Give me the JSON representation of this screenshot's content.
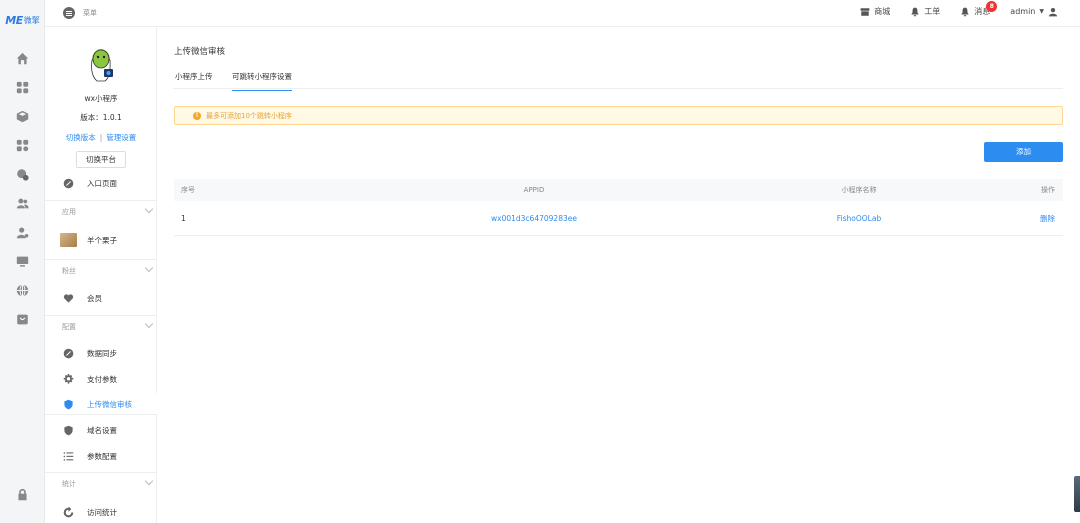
{
  "brand": {
    "logo_text": "ME",
    "logo_cn": "微擎"
  },
  "topbar": {
    "menu_label": "菜单",
    "items": [
      {
        "label": "商城",
        "icon": "store-icon"
      },
      {
        "label": "工单",
        "icon": "bell-icon"
      },
      {
        "label": "消息",
        "icon": "bell-icon",
        "badge": "8"
      }
    ],
    "user": "admin"
  },
  "app": {
    "name": "wx小程序",
    "version": "版本：1.0.1",
    "link_switch_version": "切换版本",
    "link_separator": "|",
    "link_manage": "管理设置",
    "switch_platform": "切换平台"
  },
  "subnav": {
    "entry_page": "入口页面",
    "groups": [
      {
        "title": "应用",
        "items": [
          {
            "label": "羊个栗子"
          }
        ]
      },
      {
        "title": "粉丝",
        "items": [
          {
            "label": "会员"
          }
        ]
      },
      {
        "title": "配置",
        "items": [
          {
            "label": "数据同步"
          },
          {
            "label": "支付参数"
          },
          {
            "label": "上传微信审核",
            "active": true
          },
          {
            "label": "域名设置"
          },
          {
            "label": "参数配置"
          }
        ]
      },
      {
        "title": "统计",
        "items": [
          {
            "label": "访问统计"
          }
        ]
      }
    ]
  },
  "main": {
    "title": "上传微信审核",
    "tabs": [
      {
        "label": "小程序上传",
        "active": false
      },
      {
        "label": "可跳转小程序设置",
        "active": true
      }
    ],
    "alert": "最多可添加10个跳转小程序",
    "add_button": "添加",
    "table": {
      "headers": [
        "序号",
        "APPID",
        "小程序名称",
        "操作"
      ],
      "rows": [
        {
          "index": "1",
          "appid": "wx001d3c64709283ee",
          "name": "FishoOOLab",
          "action": "删除"
        }
      ]
    }
  },
  "colors": {
    "accent": "#2d8cf0",
    "warning_bg": "#fff9e6",
    "warning_text": "#e6a23c",
    "badge": "#e33333"
  }
}
